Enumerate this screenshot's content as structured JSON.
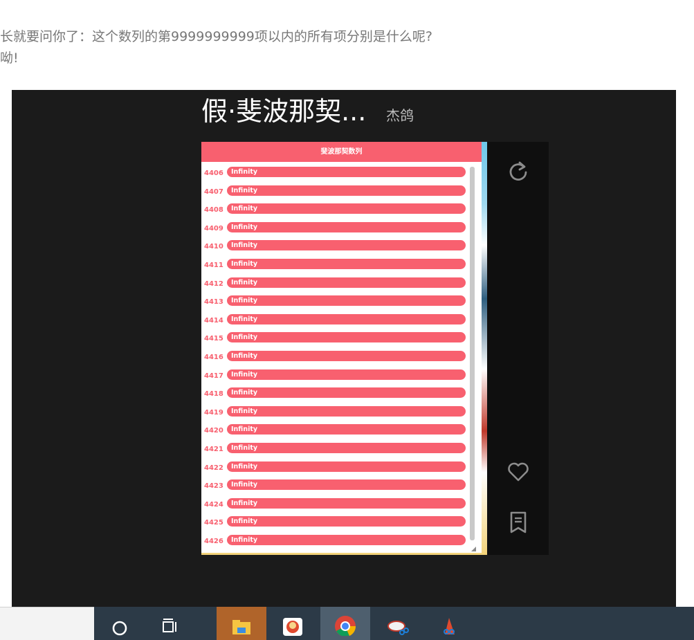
{
  "article": {
    "line1": "长就要问你了：这个数列的第9999999999项以内的所有项分别是什么呢?",
    "line2": "呦!"
  },
  "card": {
    "title": "假·斐波那契...",
    "author": "杰鸽"
  },
  "app": {
    "header": "斐波那契数列",
    "rows": [
      {
        "index": "4406",
        "value": "Infinity"
      },
      {
        "index": "4407",
        "value": "Infinity"
      },
      {
        "index": "4408",
        "value": "Infinity"
      },
      {
        "index": "4409",
        "value": "Infinity"
      },
      {
        "index": "4410",
        "value": "Infinity"
      },
      {
        "index": "4411",
        "value": "Infinity"
      },
      {
        "index": "4412",
        "value": "Infinity"
      },
      {
        "index": "4413",
        "value": "Infinity"
      },
      {
        "index": "4414",
        "value": "Infinity"
      },
      {
        "index": "4415",
        "value": "Infinity"
      },
      {
        "index": "4416",
        "value": "Infinity"
      },
      {
        "index": "4417",
        "value": "Infinity"
      },
      {
        "index": "4418",
        "value": "Infinity"
      },
      {
        "index": "4419",
        "value": "Infinity"
      },
      {
        "index": "4420",
        "value": "Infinity"
      },
      {
        "index": "4421",
        "value": "Infinity"
      },
      {
        "index": "4422",
        "value": "Infinity"
      },
      {
        "index": "4423",
        "value": "Infinity"
      },
      {
        "index": "4424",
        "value": "Infinity"
      },
      {
        "index": "4425",
        "value": "Infinity"
      },
      {
        "index": "4426",
        "value": "Infinity"
      }
    ]
  },
  "side_actions": [
    {
      "name": "reload-button",
      "icon": "reload-icon"
    },
    {
      "name": "like-button",
      "icon": "heart-icon"
    },
    {
      "name": "bookmark-button",
      "icon": "bookmark-icon"
    }
  ],
  "taskbar": {
    "items": [
      "search-circle-icon",
      "task-view-icon",
      "file-explorer-icon",
      "game-app-icon",
      "chrome-icon",
      "snipping-tool-icon",
      "screen-sketch-icon"
    ]
  },
  "colors": {
    "accent": "#f8606f",
    "panel": "#1b1b1b",
    "side": "#0f0f0f",
    "taskbar": "#2c3a47"
  }
}
